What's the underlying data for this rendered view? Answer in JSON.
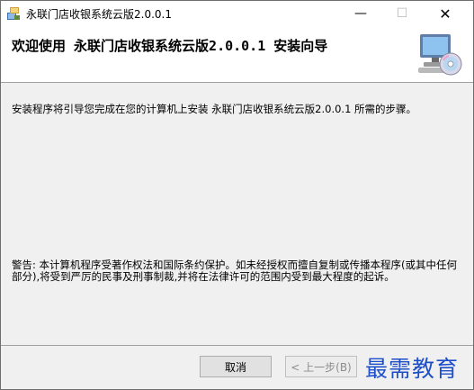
{
  "window": {
    "title": "永联门店收银系统云版2.0.0.1",
    "minimize_glyph": "—",
    "maximize_glyph": "☐",
    "close_glyph": "✕"
  },
  "header": {
    "title": "欢迎使用 永联门店收银系统云版2.0.0.1 安装向导",
    "icon": "computer-cd-icon"
  },
  "content": {
    "intro": "安装程序将引导您完成在您的计算机上安装 永联门店收银系统云版2.0.0.1 所需的步骤。",
    "warning": "警告: 本计算机程序受著作权法和国际条约保护。如未经授权而擅自复制或传播本程序(或其中任何部分),将受到严厉的民事及刑事制裁,并将在法律许可的范围内受到最大程度的起诉。"
  },
  "footer": {
    "cancel_label": "取消",
    "back_label": "< 上一步(B)"
  },
  "watermark": "最需教育"
}
